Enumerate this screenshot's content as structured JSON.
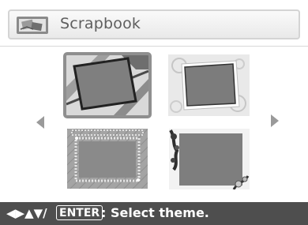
{
  "header": {
    "title": "Scrapbook",
    "icon": "scrapbook-icon"
  },
  "themes": [
    {
      "name": "theme-1",
      "selected": true
    },
    {
      "name": "theme-2",
      "selected": false
    },
    {
      "name": "theme-3",
      "selected": false
    },
    {
      "name": "theme-4",
      "selected": false
    }
  ],
  "navigation": {
    "prev_icon": "arrow-left-icon",
    "next_icon": "arrow-right-icon"
  },
  "status_bar": {
    "keys": "◀▶▲▼/",
    "enter_label": "ENTER",
    "message": ": Select theme."
  },
  "colors": {
    "status_bg": "#4e4e4e",
    "photo_area": "#808080",
    "selection_frame": "#8f8f8f"
  }
}
